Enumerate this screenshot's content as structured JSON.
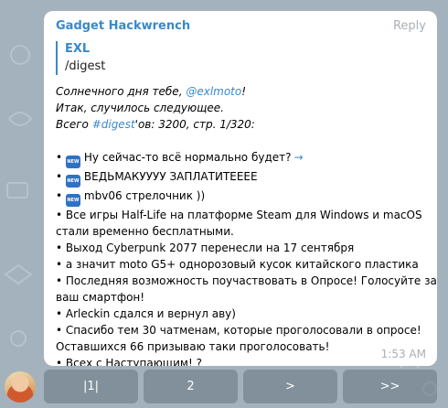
{
  "message": {
    "sender": "Gadget Hackwrench",
    "reply_label": "Reply",
    "quote": {
      "author": "EXL",
      "text": "/digest"
    },
    "intro": {
      "greeting_prefix": "Солнечного дня тебе, ",
      "mention": "@exlmoto",
      "greeting_suffix": "!",
      "line2": "Итак, случилось следующее.",
      "total_prefix": "Всего ",
      "hashtag": "#digest",
      "total_suffix": "'ов: 3200, стр. 1/320:"
    },
    "badge_text": "NEW",
    "new_items": [
      "Ну сейчас-то всё нормально будет?",
      "ВЕДЬМАКУУУУ ЗАПЛАТИТЕЕЕЕ",
      "mbv06 стрелочник ))"
    ],
    "arrow": "→",
    "bullet_lines": [
      "• Все игры Half-Life на платформе Steam для Windows и macOS",
      "стали временно бесплатными.",
      "• Выход Cyberpunk 2077 перенесли на 17 сентября",
      "• а значит moto G5+ однорозовый кусок китайского пластика",
      "• Последняя возможность поучаствовать в Опросе! Голосуйте за",
      "ваш смартфон!",
      "• Arleckin сдался и вернул аву)",
      "• Спасибо тем 30 чатменам, которые проголосовали в опросе!",
      "Оставшихся 66 призываю таки проголосовать!",
      "• Всех с Наступающим! ?"
    ],
    "time": "1:53 AM"
  },
  "keyboard": {
    "buttons": [
      {
        "label": "|1|"
      },
      {
        "label": "2"
      },
      {
        "label": ">"
      },
      {
        "label": ">>"
      }
    ]
  },
  "colors": {
    "wallpaper": "#a4b2bd",
    "accent": "#3a89c9",
    "badge": "#2f72c4",
    "muted": "#a8b0b7"
  },
  "icons": {
    "avatar": "anime-girl-avatar",
    "badge": "new-emoji-badge"
  }
}
